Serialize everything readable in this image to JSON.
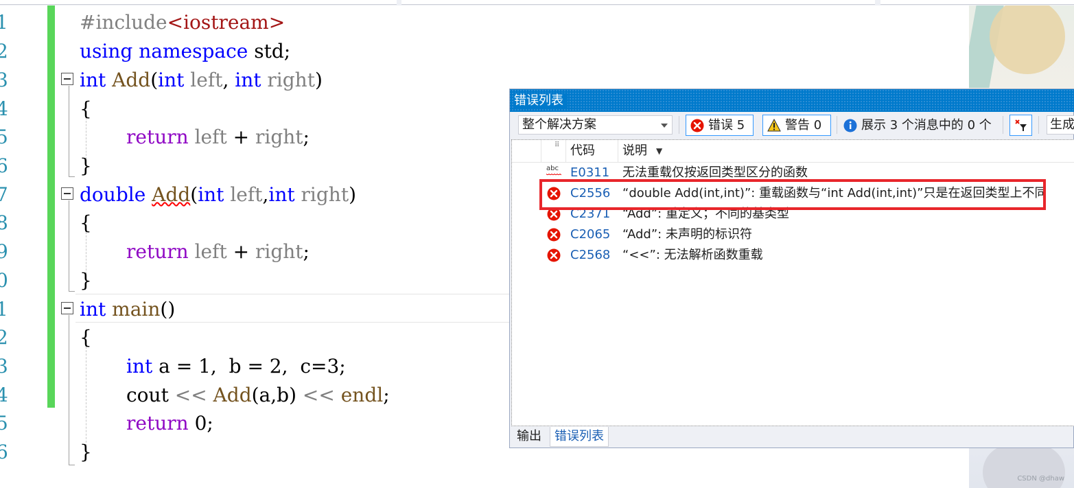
{
  "editor": {
    "line_numbers": [
      "1",
      "2",
      "3",
      "4",
      "5",
      "6",
      "7",
      "8",
      "9",
      "0",
      "1",
      "2",
      "3",
      "4",
      "5",
      "6"
    ],
    "lines": {
      "l1": {
        "pre": "#include",
        "inc": "<iostream>"
      },
      "l2": {
        "kw1": "using",
        "kw2": "namespace",
        "rest": " std;"
      },
      "l3": {
        "t1": "int",
        "fn": " Add",
        "p1": "(",
        "t2": "int",
        "a1": " left",
        "c1": ", ",
        "t3": "int",
        "a2": " right",
        "p2": ")"
      },
      "l4": "{",
      "l5": {
        "ret": "return",
        "a1": " left",
        "op": " + ",
        "a2": "right",
        "end": ";"
      },
      "l6": "}",
      "l7": {
        "t1": "double",
        "fn": "Add",
        "p1": "(",
        "t2": "int",
        "a1": " left",
        "c1": ",",
        "t3": "int",
        "a2": " right",
        "p2": ")"
      },
      "l8": "{",
      "l9": {
        "ret": "return",
        "a1": " left",
        "op": " + ",
        "a2": "right",
        "end": ";"
      },
      "l10": "}",
      "l11": {
        "t1": "int",
        "fn": " main",
        "rest": "()"
      },
      "l12": "{",
      "l13": {
        "t1": "int",
        "rest": " a = 1,  b = 2,  c=3;"
      },
      "l14": {
        "a": "cout ",
        "op1": "<<",
        "fn": " Add",
        "mid": "(a,b) ",
        "op2": "<<",
        "endl": " endl",
        "end": ";"
      },
      "l15": {
        "ret": "return",
        "rest": " 0;"
      },
      "l16": "}"
    }
  },
  "error_list": {
    "title": "错误列表",
    "scope": "整个解决方案",
    "errors_btn": "错误 5",
    "warnings_btn": "警告 0",
    "messages": "展示 3 个消息中的 0 个",
    "build_dropdown": "生成",
    "columns": {
      "code": "代码",
      "description": "说明"
    },
    "rows": [
      {
        "icon": "intellisense-abc-icon",
        "code": "E0311",
        "desc": "无法重载仅按返回类型区分的函数"
      },
      {
        "icon": "error-icon",
        "code": "C2556",
        "desc": "“double Add(int,int)”: 重载函数与“int Add(int,int)”只是在返回类型上不同"
      },
      {
        "icon": "error-icon",
        "code": "C2371",
        "desc": "“Add”: 重定义；不同的基类型"
      },
      {
        "icon": "error-icon",
        "code": "C2065",
        "desc": "“Add”: 未声明的标识符"
      },
      {
        "icon": "error-icon",
        "code": "C2568",
        "desc": "“<<”: 无法解析函数重载"
      }
    ],
    "tabs": [
      "输出",
      "错误列表"
    ]
  },
  "watermark": "CSDN @dhaw",
  "colors": {
    "accent": "#007acc",
    "error": "#e51400",
    "highlight": "#e8262b",
    "change_bar": "#59d65a"
  }
}
